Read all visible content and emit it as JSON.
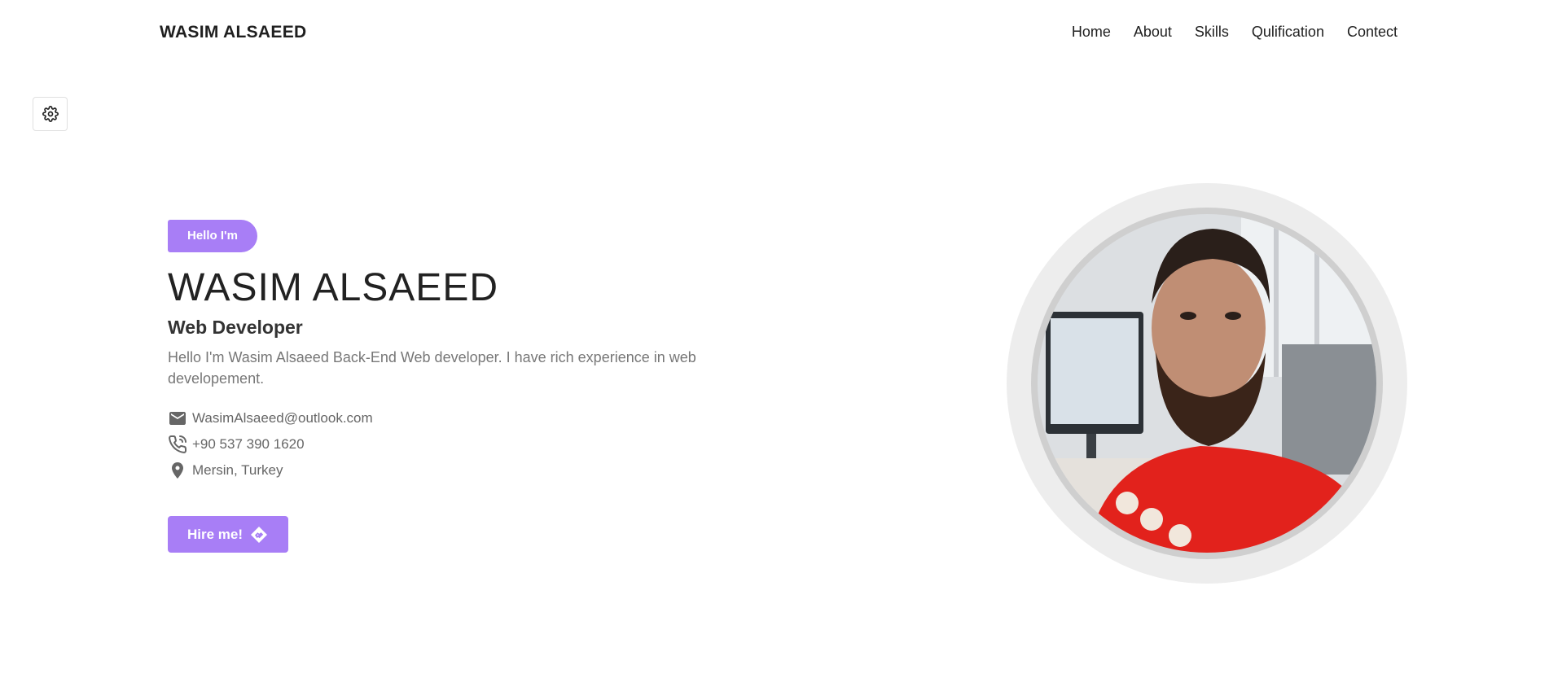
{
  "header": {
    "logo": "WASIM ALSAEED",
    "nav": [
      "Home",
      "About",
      "Skills",
      "Qulification",
      "Contect"
    ]
  },
  "settings": {
    "icon": "gear-icon"
  },
  "hero": {
    "badge": "Hello I'm",
    "name": "WASIM ALSAEED",
    "role": "Web Developer",
    "bio": "Hello I'm Wasim Alsaeed Back-End Web developer. I have rich experience in web developement.",
    "contacts": {
      "email": "WasimAlsaeed@outlook.com",
      "phone": "+90 537 390 1620",
      "location": "Mersin, Turkey"
    },
    "hire_label": "Hire me!",
    "hire_icon": "handshake-icon"
  },
  "colors": {
    "accent": "#a87ef6",
    "text": "#222222",
    "muted": "#777777"
  }
}
